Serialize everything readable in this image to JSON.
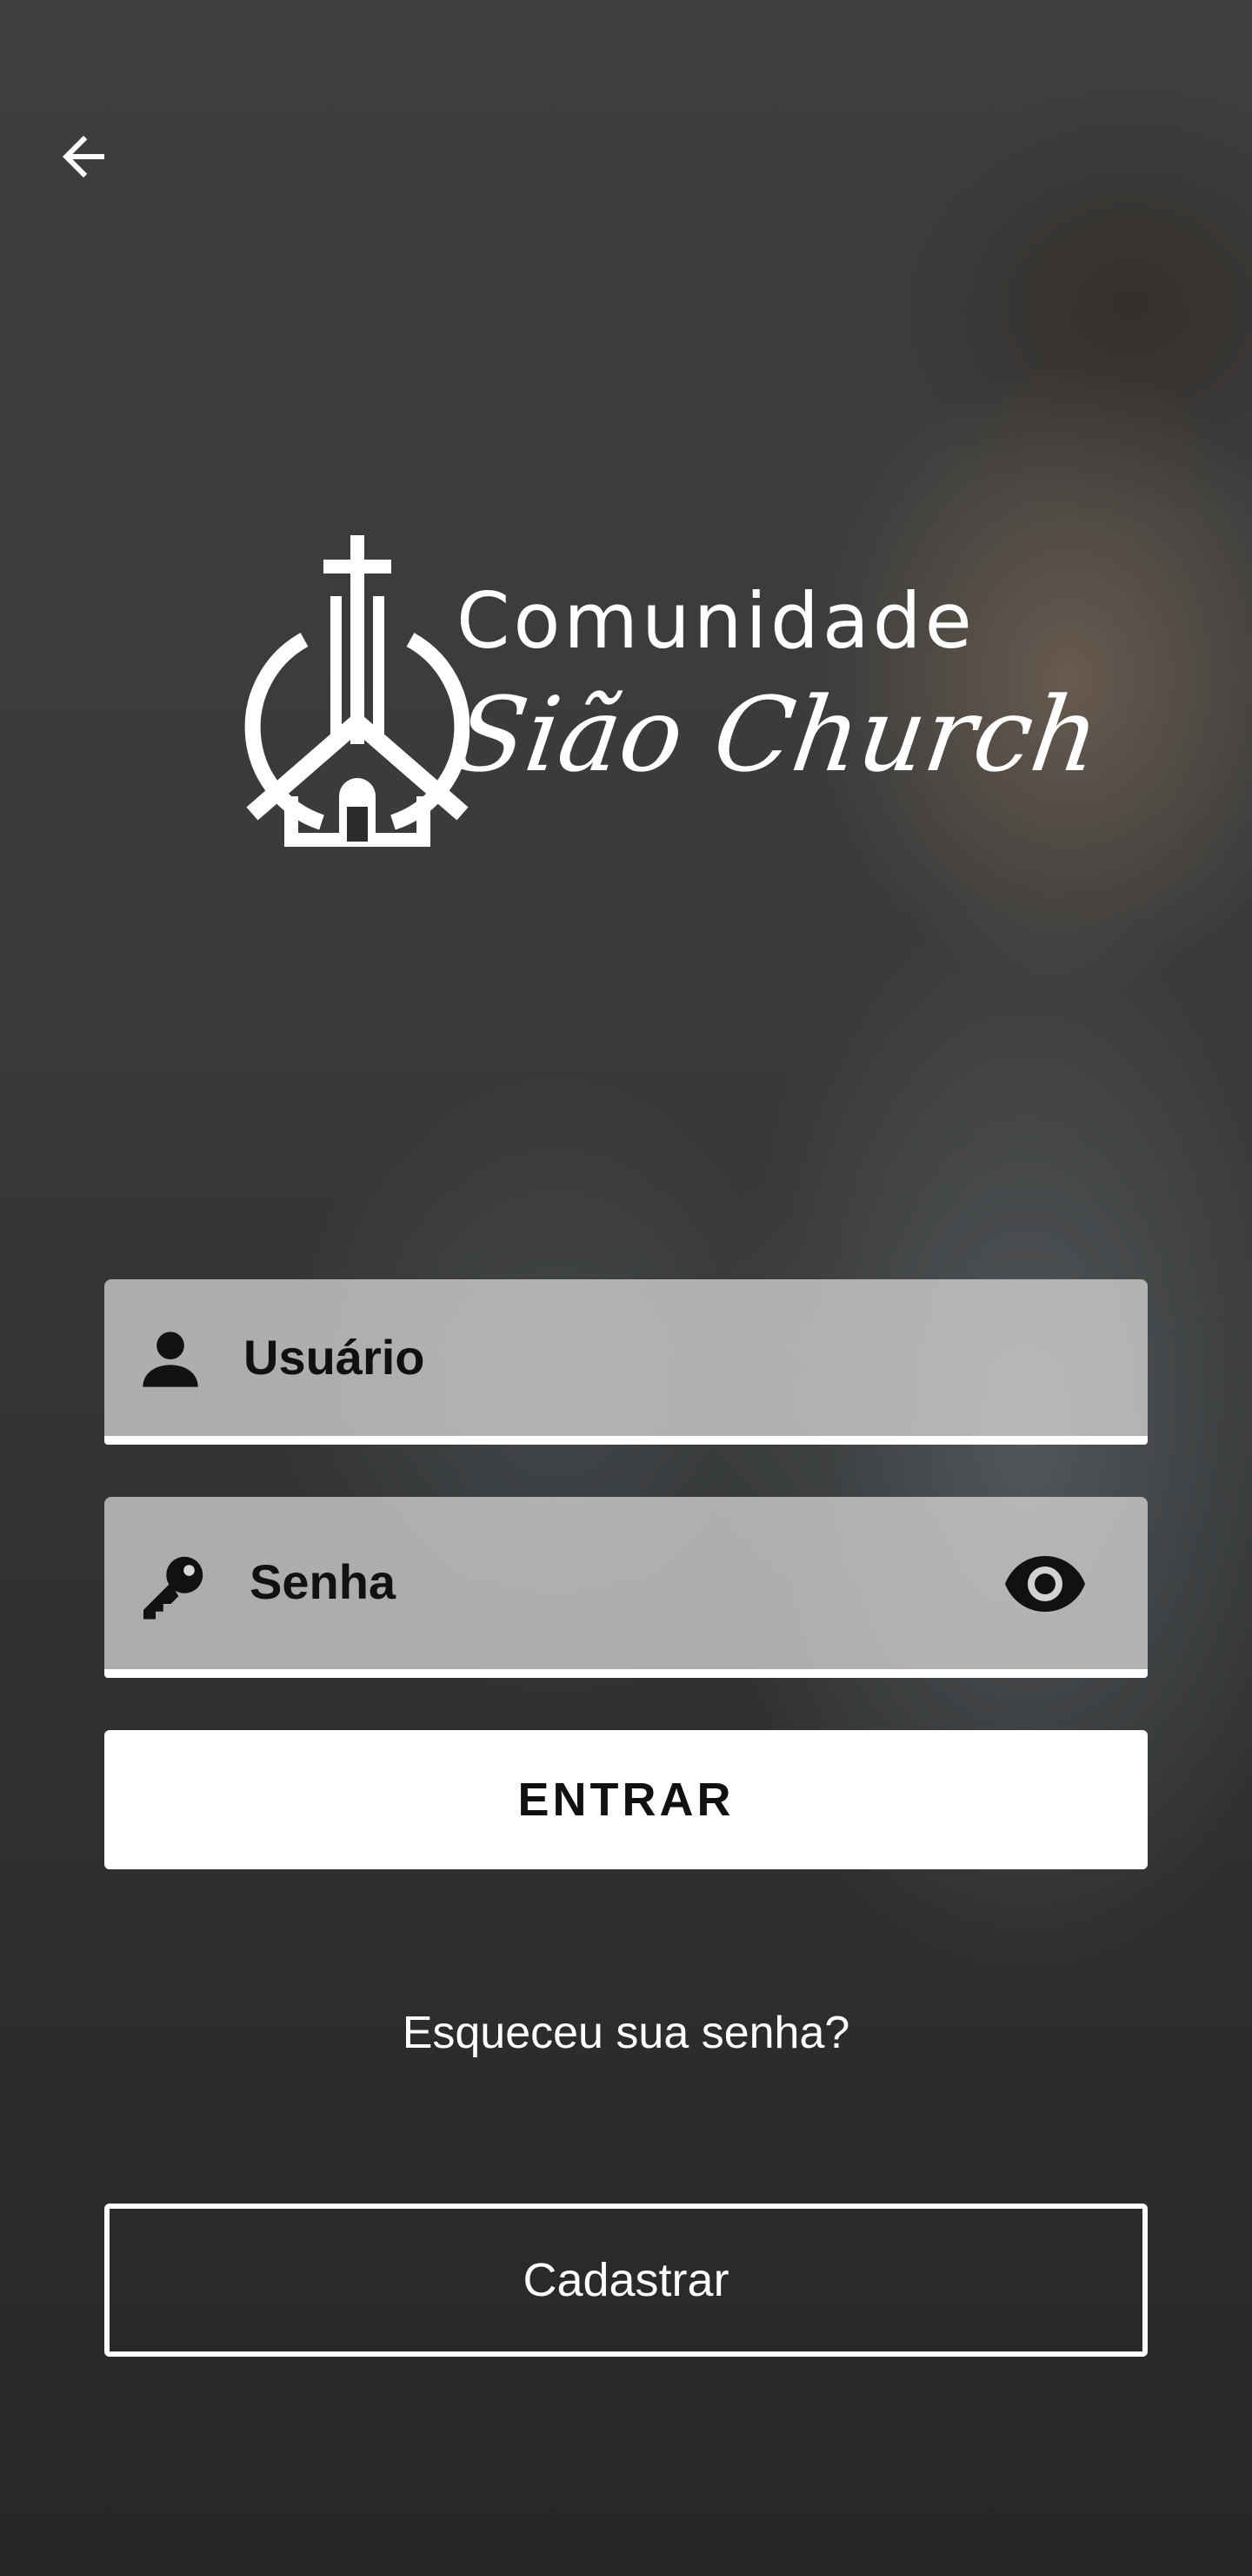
{
  "header": {
    "back_icon": "arrow-left-icon"
  },
  "logo": {
    "line1": "Comunidade",
    "line2": "Sião Church",
    "icon": "church-logo-icon"
  },
  "form": {
    "username": {
      "placeholder": "Usuário",
      "icon": "user-icon"
    },
    "password": {
      "placeholder": "Senha",
      "icon": "key-icon",
      "toggle_icon": "eye-icon"
    },
    "submit_label": "ENTRAR",
    "forgot_label": "Esqueceu sua senha?",
    "register_label": "Cadastrar"
  },
  "colors": {
    "overlay": "#2b2c2c",
    "field_bg": "#dcdcde",
    "accent": "#ffffff",
    "text_dark": "#111111"
  }
}
